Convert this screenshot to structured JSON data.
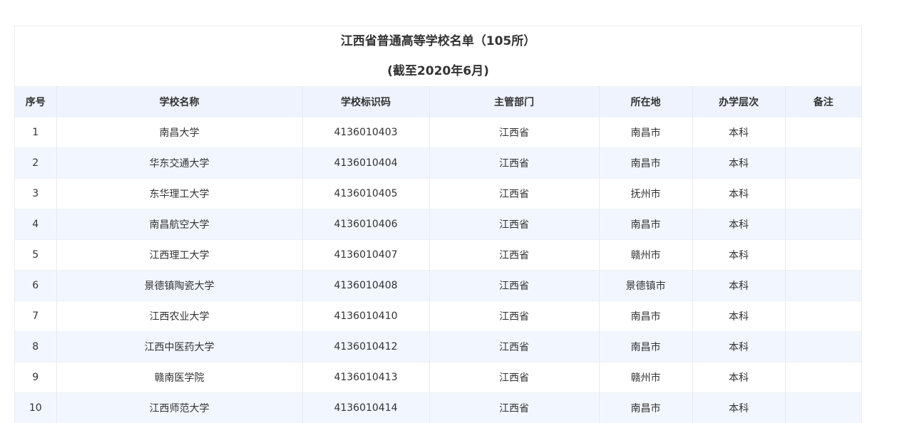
{
  "document": {
    "title": "江西省普通高等学校名单（105所）",
    "subtitle": "(截至2020年6月)"
  },
  "table": {
    "headers": [
      "序号",
      "学校名称",
      "学校标识码",
      "主管部门",
      "所在地",
      "办学层次",
      "备注"
    ],
    "rows": [
      [
        "1",
        "南昌大学",
        "4136010403",
        "江西省",
        "南昌市",
        "本科",
        ""
      ],
      [
        "2",
        "华东交通大学",
        "4136010404",
        "江西省",
        "南昌市",
        "本科",
        ""
      ],
      [
        "3",
        "东华理工大学",
        "4136010405",
        "江西省",
        "抚州市",
        "本科",
        ""
      ],
      [
        "4",
        "南昌航空大学",
        "4136010406",
        "江西省",
        "南昌市",
        "本科",
        ""
      ],
      [
        "5",
        "江西理工大学",
        "4136010407",
        "江西省",
        "赣州市",
        "本科",
        ""
      ],
      [
        "6",
        "景德镇陶瓷大学",
        "4136010408",
        "江西省",
        "景德镇市",
        "本科",
        ""
      ],
      [
        "7",
        "江西农业大学",
        "4136010410",
        "江西省",
        "南昌市",
        "本科",
        ""
      ],
      [
        "8",
        "江西中医药大学",
        "4136010412",
        "江西省",
        "南昌市",
        "本科",
        ""
      ],
      [
        "9",
        "赣南医学院",
        "4136010413",
        "江西省",
        "赣州市",
        "本科",
        ""
      ],
      [
        "10",
        "江西师范大学",
        "4136010414",
        "江西省",
        "南昌市",
        "本科",
        ""
      ]
    ]
  }
}
